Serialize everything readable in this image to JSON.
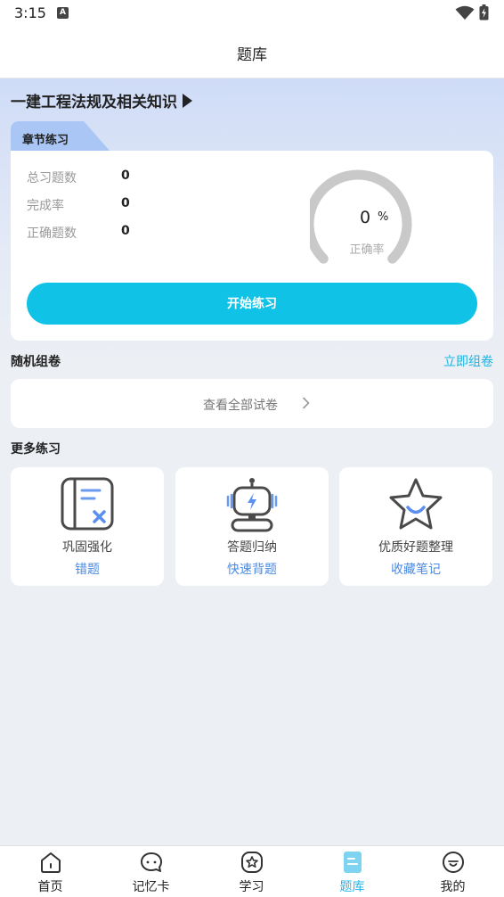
{
  "status_bar": {
    "time": "3:15"
  },
  "header": {
    "title": "题库"
  },
  "subject": {
    "name": "一建工程法规及相关知识"
  },
  "chapter_practice": {
    "tab_label": "章节练习",
    "stats": [
      {
        "label": "总习题数",
        "value": "0"
      },
      {
        "label": "完成率",
        "value": "0"
      },
      {
        "label": "正确题数",
        "value": "0"
      }
    ],
    "accuracy": {
      "value": "0",
      "unit": "%",
      "label": "正确率",
      "fraction": 0
    },
    "start_button": "开始练习"
  },
  "random_paper": {
    "title": "随机组卷",
    "link": "立即组卷",
    "view_all": "查看全部试卷"
  },
  "more_practice": {
    "title": "更多练习",
    "cards": [
      {
        "title": "巩固强化",
        "link": "错题",
        "icon": "wrong-notebook-icon"
      },
      {
        "title": "答题归纳",
        "link": "快速背题",
        "icon": "robot-icon"
      },
      {
        "title": "优质好题整理",
        "link": "收藏笔记",
        "icon": "star-icon"
      }
    ]
  },
  "bottom_nav": {
    "items": [
      {
        "label": "首页",
        "icon": "home-icon"
      },
      {
        "label": "记忆卡",
        "icon": "chat-bubble-icon"
      },
      {
        "label": "学习",
        "icon": "star-badge-icon"
      },
      {
        "label": "题库",
        "icon": "question-bank-icon",
        "active": true
      },
      {
        "label": "我的",
        "icon": "profile-face-icon"
      }
    ]
  },
  "colors": {
    "accent": "#10c2e6",
    "link": "#4a8ae0",
    "active_nav": "#29b6e8"
  }
}
